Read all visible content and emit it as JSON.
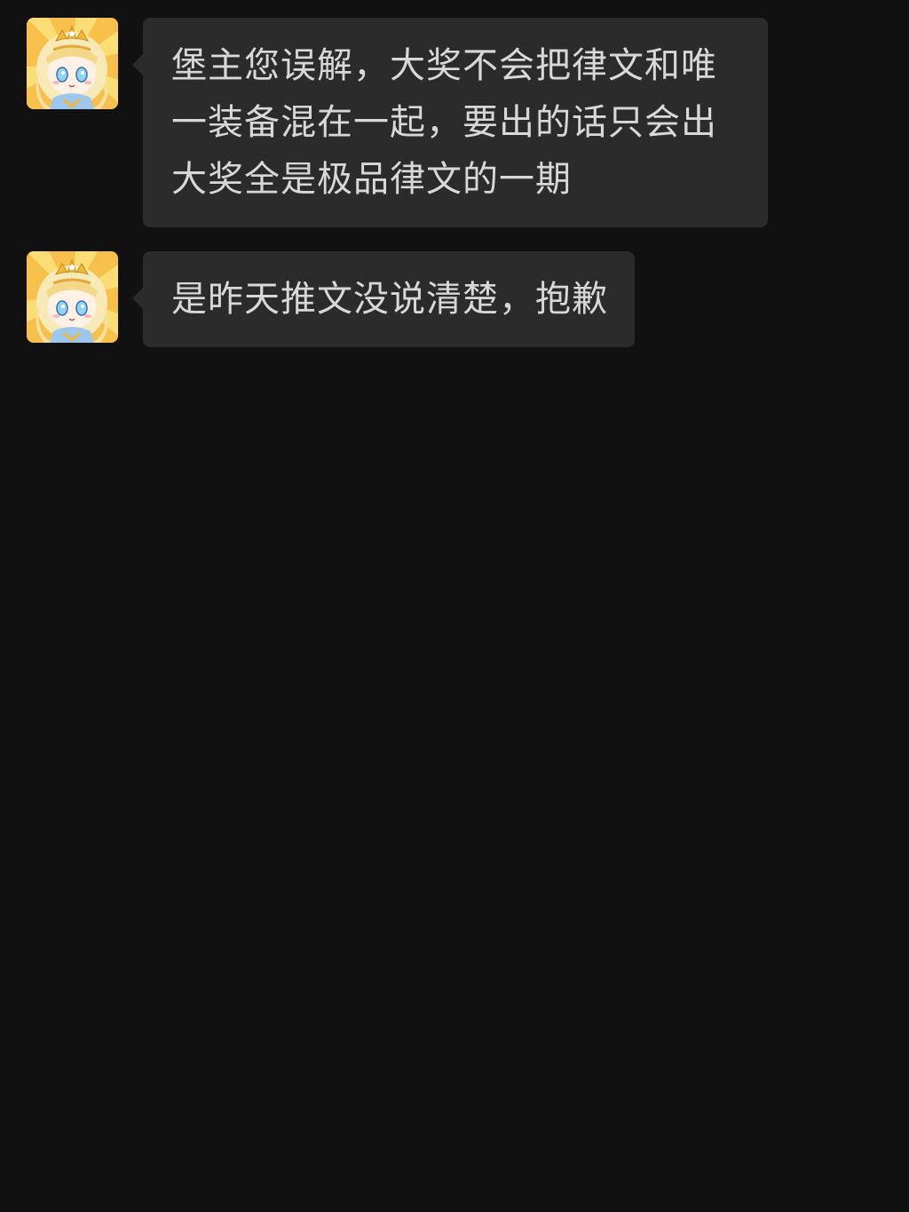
{
  "messages": [
    {
      "sender_avatar": "anime-princess-avatar",
      "text": "堡主您误解，大奖不会把律文和唯一装备混在一起，要出的话只会出大奖全是极品律文的一期"
    },
    {
      "sender_avatar": "anime-princess-avatar",
      "text": "是昨天推文没说清楚，抱歉"
    }
  ],
  "colors": {
    "background": "#111111",
    "bubble": "#2b2b2b",
    "text": "#d8d8d8",
    "avatar_bg": "#f4b63a"
  }
}
